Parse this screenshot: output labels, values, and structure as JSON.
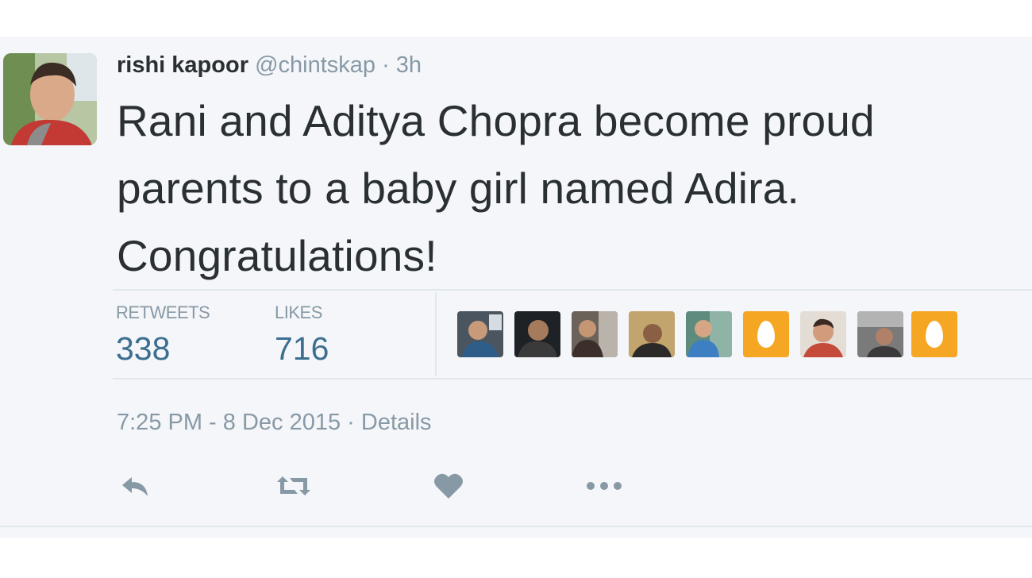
{
  "tweet": {
    "author_name": "rishi kapoor",
    "handle": "@chintskap",
    "separator": " · ",
    "relative_time": "3h",
    "text_lines": [
      "Rani and Aditya Chopra become proud",
      "parents to a baby girl named Adira.",
      "Congratulations!"
    ]
  },
  "stats": {
    "retweets_label": "RETWEETS",
    "retweets_value": "338",
    "likes_label": "LIKES",
    "likes_value": "716"
  },
  "meta": {
    "timestamp": "7:25 PM - 8 Dec 2015",
    "separator": " · ",
    "details_label": "Details"
  },
  "actions": [
    "reply-icon",
    "retweet-icon",
    "like-icon",
    "more-icon"
  ],
  "colors": {
    "card_background": "#f4f6f9",
    "text_primary": "#292f33",
    "text_secondary": "#8899a6",
    "stat_value": "#3b6e8f",
    "egg_avatar": "#f5a623"
  }
}
